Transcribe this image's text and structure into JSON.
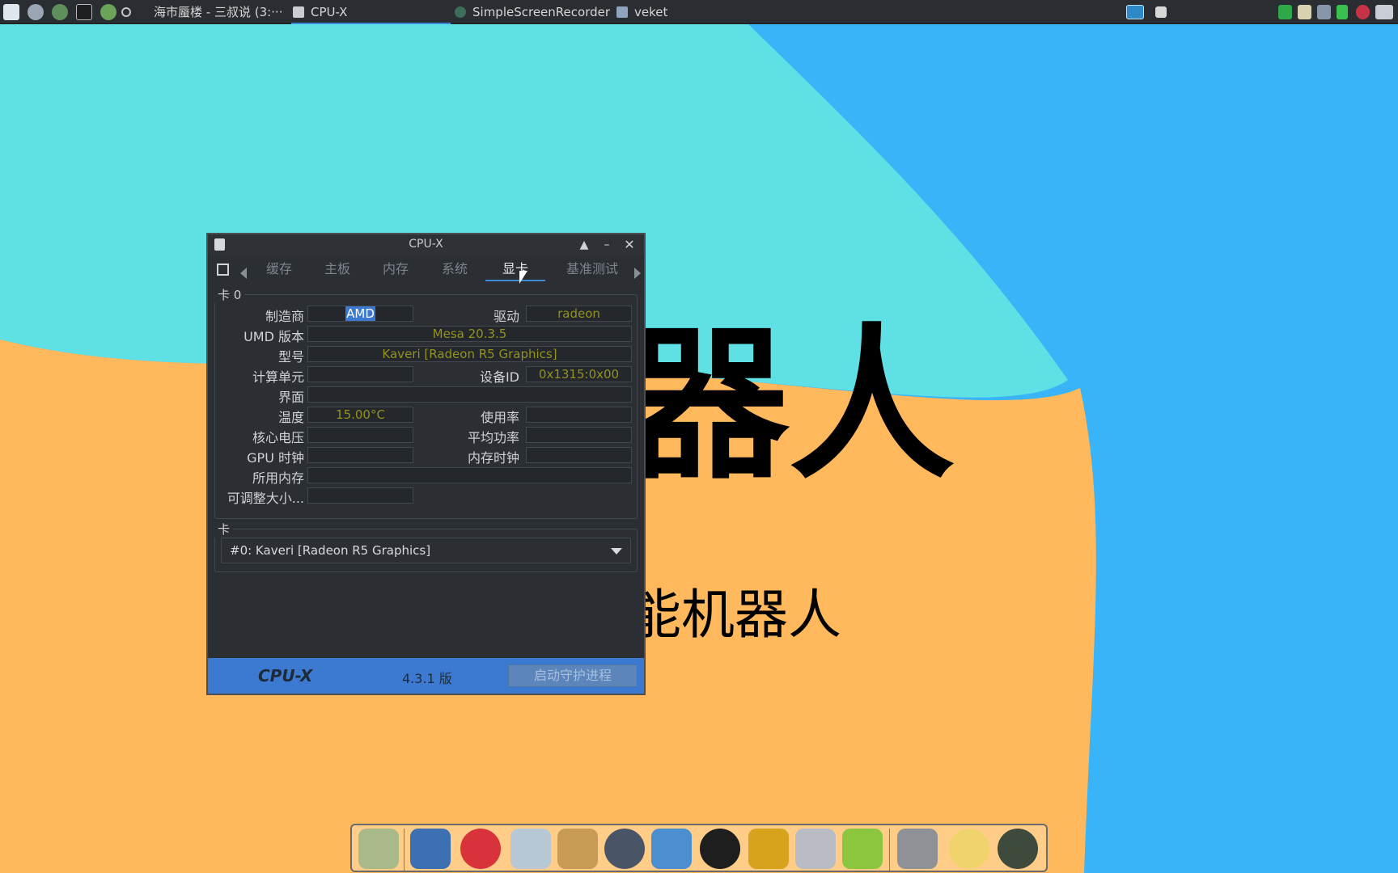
{
  "desktop": {
    "big_text": "器人",
    "sub_text": "能机器人",
    "colors": {
      "teal": "#5fe0e4",
      "blue": "#3ab4f8",
      "orange": "#ffb95c"
    }
  },
  "taskbar": {
    "tasks": [
      {
        "label": "海市蜃楼 - 三叔说 (3:···",
        "icon": "browser-icon"
      },
      {
        "label": "CPU-X",
        "icon": "cpux-icon",
        "active": true
      },
      {
        "label": "SimpleScreenRecorder",
        "icon": "recorder-icon"
      },
      {
        "label": "veket",
        "icon": "folder-icon"
      }
    ]
  },
  "window": {
    "title": "CPU-X",
    "tabs": [
      "缓存",
      "主板",
      "内存",
      "系统",
      "显卡",
      "基准测试"
    ],
    "active_tab": "显卡",
    "card_frame_title": "卡 0",
    "fields": {
      "vendor_label": "制造商",
      "vendor_value": "AMD",
      "driver_label": "驱动",
      "driver_value": "radeon",
      "umd_label": "UMD 版本",
      "umd_value": "Mesa 20.3.5",
      "model_label": "型号",
      "model_value": "Kaveri [Radeon R5 Graphics]",
      "cu_label": "计算单元",
      "cu_value": "",
      "device_id_label": "设备ID",
      "device_id_value": "0x1315:0x00",
      "interface_label": "界面",
      "interface_value": "",
      "temp_label": "温度",
      "temp_value": "15.00°C",
      "usage_label": "使用率",
      "usage_value": "",
      "voltage_label": "核心电压",
      "voltage_value": "",
      "power_label": "平均功率",
      "power_value": "",
      "gpu_clock_label": "GPU 时钟",
      "gpu_clock_value": "",
      "mem_clock_label": "内存时钟",
      "mem_clock_value": "",
      "mem_used_label": "所用内存",
      "mem_used_value": "",
      "resizable_label": "可调整大小...",
      "resizable_value": ""
    },
    "card_select_frame_title": "卡",
    "card_select_value": "#0: Kaveri [Radeon R5 Graphics]",
    "footer": {
      "brand": "CPU-X",
      "version": "4.3.1 版",
      "daemon_button": "启动守护进程"
    }
  },
  "dock": {
    "icons": [
      "file-manager-icon",
      "monitor-icon",
      "mascot-icon",
      "editor-icon",
      "paint-icon",
      "media-icon",
      "users-icon",
      "penguin-icon",
      "notebook-icon",
      "charts-icon",
      "help-icon",
      "drive-icon",
      "sun-icon",
      "globe-icon"
    ]
  }
}
